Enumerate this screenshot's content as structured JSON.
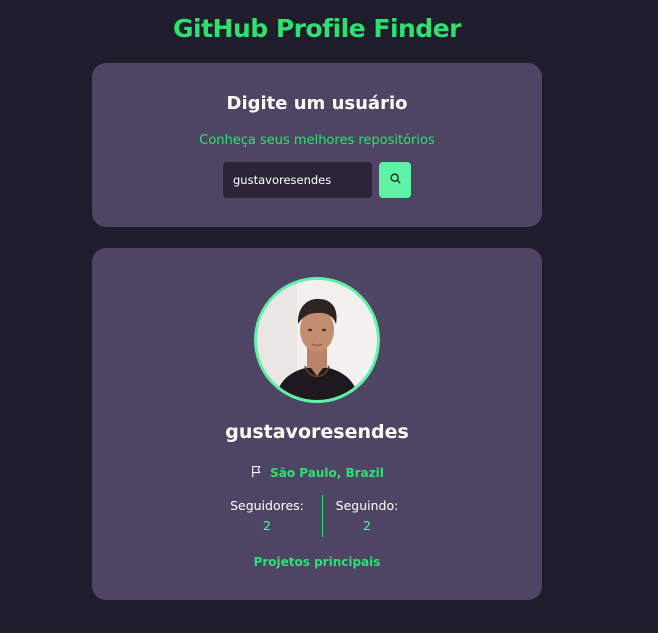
{
  "app": {
    "title": "GitHub Profile Finder"
  },
  "search": {
    "heading": "Digite um usuário",
    "subtitle": "Conheça seus melhores repositórios",
    "input_value": "gustavoresendes",
    "button_icon": "search-icon"
  },
  "profile": {
    "avatar_icon": "avatar",
    "username": "gustavoresendes",
    "location_icon": "flag-icon",
    "location": "São Paulo, Brazil",
    "followers_label": "Seguidores:",
    "followers_value": "2",
    "following_label": "Seguindo:",
    "following_value": "2",
    "projects_link": "Projetos principais"
  },
  "colors": {
    "background": "#1f1c2c",
    "card": "#4e4565",
    "accent": "#2ee06f",
    "accent_light": "#5df2a6",
    "input_bg": "#2a2538"
  }
}
